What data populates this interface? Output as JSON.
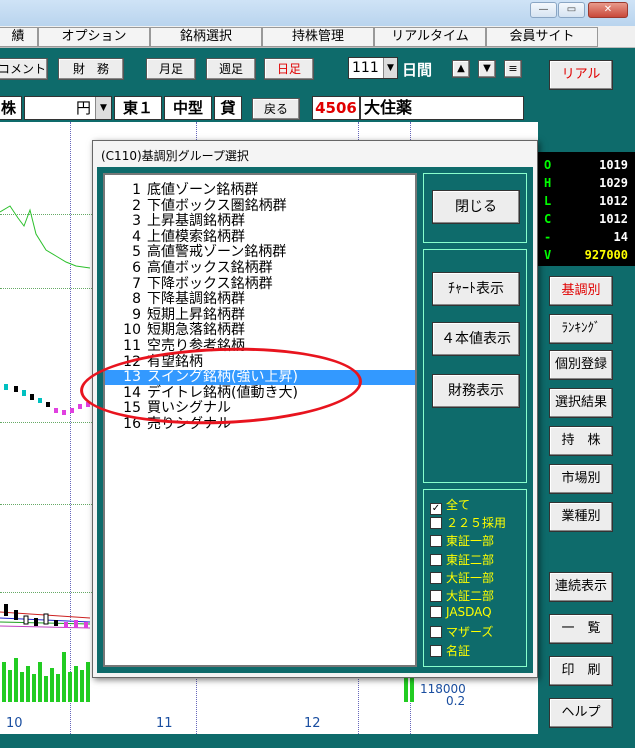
{
  "window": {
    "minimize": "—",
    "maximize": "▭",
    "close": "✕"
  },
  "menu": [
    "績",
    "オプション",
    "銘柄選択",
    "持株管理",
    "リアルタイム",
    "会員サイト"
  ],
  "toolbar": {
    "comment": "コメント",
    "finance": "財　務",
    "monthly": "月足",
    "weekly": "週足",
    "daily": "日足",
    "days_value": "111",
    "days_label": "日間",
    "up": "▲",
    "down": "▼",
    "list": "≡",
    "real_button": "リアル"
  },
  "stockbar": {
    "kabu": "株",
    "unit": "円",
    "market": "東１",
    "size": "中型",
    "loan": "貸",
    "back": "戻る",
    "code": "4506",
    "name": "大住薬"
  },
  "quote": [
    {
      "k": "O",
      "v": "1019"
    },
    {
      "k": "H",
      "v": "1029"
    },
    {
      "k": "L",
      "v": "1012"
    },
    {
      "k": "C",
      "v": "1012"
    },
    {
      "k": "-",
      "v": "14"
    },
    {
      "k": "V",
      "v": "927000"
    }
  ],
  "right_buttons": [
    "基調別",
    "ﾗﾝｷﾝｸﾞ",
    "個別登録",
    "選択結果",
    "持　株",
    "市場別",
    "業種別",
    "連続表示",
    "一　覧",
    "印　刷",
    "ヘルプ"
  ],
  "chart": {
    "x_ticks": [
      "10",
      "11",
      "12"
    ],
    "vol_labels": [
      "118000",
      "0.2"
    ]
  },
  "dialog": {
    "title": "(C110)基調別グループ選択",
    "items": [
      {
        "n": "1",
        "label": "底値ゾーン銘柄群"
      },
      {
        "n": "2",
        "label": "下値ボックス圏銘柄群"
      },
      {
        "n": "3",
        "label": "上昇基調銘柄群"
      },
      {
        "n": "4",
        "label": "上値模索銘柄群"
      },
      {
        "n": "5",
        "label": "高値警戒ゾーン銘柄群"
      },
      {
        "n": "6",
        "label": "高値ボックス銘柄群"
      },
      {
        "n": "7",
        "label": "下降ボックス銘柄群"
      },
      {
        "n": "8",
        "label": "下降基調銘柄群"
      },
      {
        "n": "9",
        "label": "短期上昇銘柄群"
      },
      {
        "n": "10",
        "label": "短期急落銘柄群"
      },
      {
        "n": "11",
        "label": "空売り参考銘柄"
      },
      {
        "n": "12",
        "label": "有望銘柄"
      },
      {
        "n": "13",
        "label": "スイング銘柄(強い上昇)"
      },
      {
        "n": "14",
        "label": "デイトレ銘柄(値動き大)"
      },
      {
        "n": "15",
        "label": "買いシグナル"
      },
      {
        "n": "16",
        "label": "売りシグナル"
      }
    ],
    "selected_index": 12,
    "buttons": {
      "close": "閉じる",
      "chart": "ﾁｬｰﾄ表示",
      "four": "４本値表示",
      "finance": "財務表示"
    },
    "filters": [
      {
        "label": "全て",
        "checked": true
      },
      {
        "label": "２２５採用",
        "checked": false
      },
      {
        "label": "東証一部",
        "checked": false
      },
      {
        "label": "東証二部",
        "checked": false
      },
      {
        "label": "大証一部",
        "checked": false
      },
      {
        "label": "大証二部",
        "checked": false
      },
      {
        "label": "JASDAQ",
        "checked": false
      },
      {
        "label": "マザーズ",
        "checked": false
      },
      {
        "label": "名証",
        "checked": false
      }
    ]
  },
  "colors": {
    "accent": "#0e6b6b",
    "selection": "#3399ff",
    "highlight": "#e8141e"
  }
}
